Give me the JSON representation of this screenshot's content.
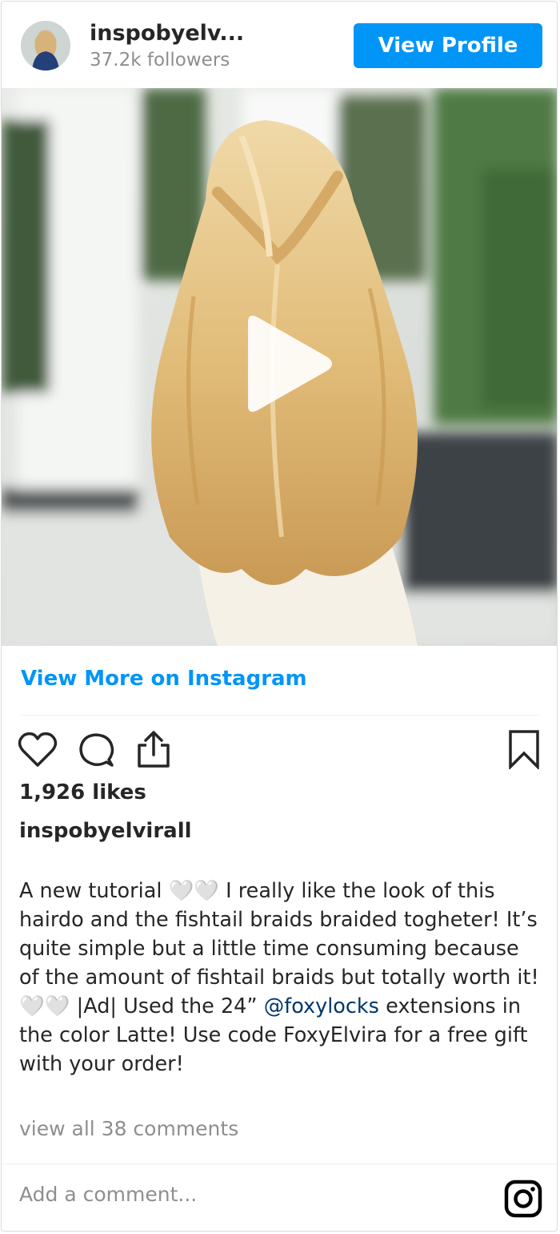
{
  "header": {
    "username": "inspobyelv...",
    "followers": "37.2k followers",
    "view_profile_label": "View Profile"
  },
  "media": {
    "type": "video",
    "play_icon": "play-icon"
  },
  "view_more_label": "View More on Instagram",
  "actions": {
    "icons": [
      "heart-icon",
      "comment-icon",
      "share-icon",
      "bookmark-icon"
    ]
  },
  "likes": "1,926 likes",
  "author": "inspobyelvirall",
  "caption": {
    "before_mention": "A new tutorial 🤍🤍 I really like the look of this hairdo and the fishtail braids braided togheter! It’s quite simple but a little time consuming because of the amount of fishtail braids but totally worth it! 🤍🤍 |Ad| Used the 24” ",
    "mention": "@foxylocks",
    "after_mention": " extensions in the color Latte! Use code FoxyElvira for a free gift with your order!"
  },
  "view_comments": "view all 38 comments",
  "comment_placeholder": "Add a comment...",
  "colors": {
    "accent": "#0095f6",
    "mention": "#00376b",
    "muted": "#8e8e8e",
    "text": "#262626"
  }
}
